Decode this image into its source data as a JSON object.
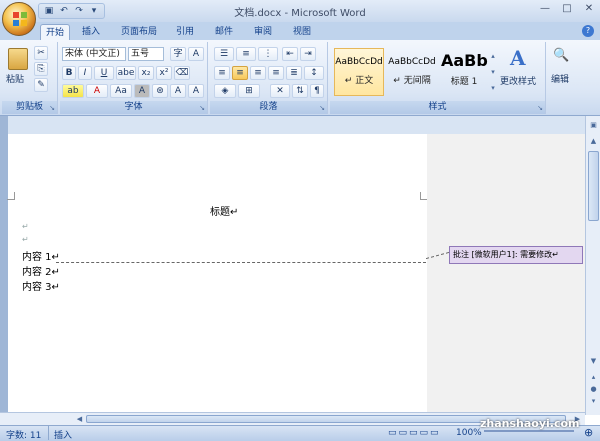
{
  "window": {
    "title": "文档.docx - Microsoft Word",
    "controls": [
      "—",
      "□",
      "✕"
    ]
  },
  "qat": {
    "items": [
      "save-icon",
      "undo-icon",
      "redo-icon",
      "customize-icon"
    ],
    "glyphs": [
      "💾",
      "↶",
      "↷",
      "▾"
    ]
  },
  "tabs": [
    {
      "label": "开始",
      "active": true
    },
    {
      "label": "插入"
    },
    {
      "label": "页面布局"
    },
    {
      "label": "引用"
    },
    {
      "label": "邮件"
    },
    {
      "label": "审阅"
    },
    {
      "label": "视图"
    }
  ],
  "ribbon": {
    "clipboard": {
      "label": "剪贴板",
      "paste": "粘贴"
    },
    "font": {
      "label": "字体",
      "font_name": "宋体 (中文正)",
      "font_size": "五号",
      "buttons": [
        "B",
        "I",
        "U",
        "abe",
        "x₂",
        "x²",
        "Aa",
        "A",
        "A",
        "A",
        "A"
      ]
    },
    "paragraph": {
      "label": "段落"
    },
    "styles": {
      "label": "样式",
      "items": [
        {
          "sample": "AaBbCcDd",
          "name": "↵ 正文",
          "selected": true
        },
        {
          "sample": "AaBbCcDd",
          "name": "↵ 无间隔"
        },
        {
          "sample": "AaBb",
          "name": "标题 1"
        }
      ],
      "change_styles": "更改样式"
    },
    "editing": {
      "label": "编辑"
    }
  },
  "document": {
    "heading": "标题↵",
    "empty_lines": [
      "↵",
      "↵"
    ],
    "lines": [
      "内容 1↵",
      "内容 2↵",
      "内容 3↵"
    ]
  },
  "comment": {
    "text": "批注 [微软用户1]: 需要修改↵"
  },
  "status": {
    "word_count": "字数: 11",
    "mode": "插入",
    "zoom": "100%"
  },
  "watermark": "zhanshaoyi.com",
  "colors": {
    "ribbon": "#dbe6f5",
    "accent": "#15428b",
    "comment_bg": "#e3d7f0"
  }
}
